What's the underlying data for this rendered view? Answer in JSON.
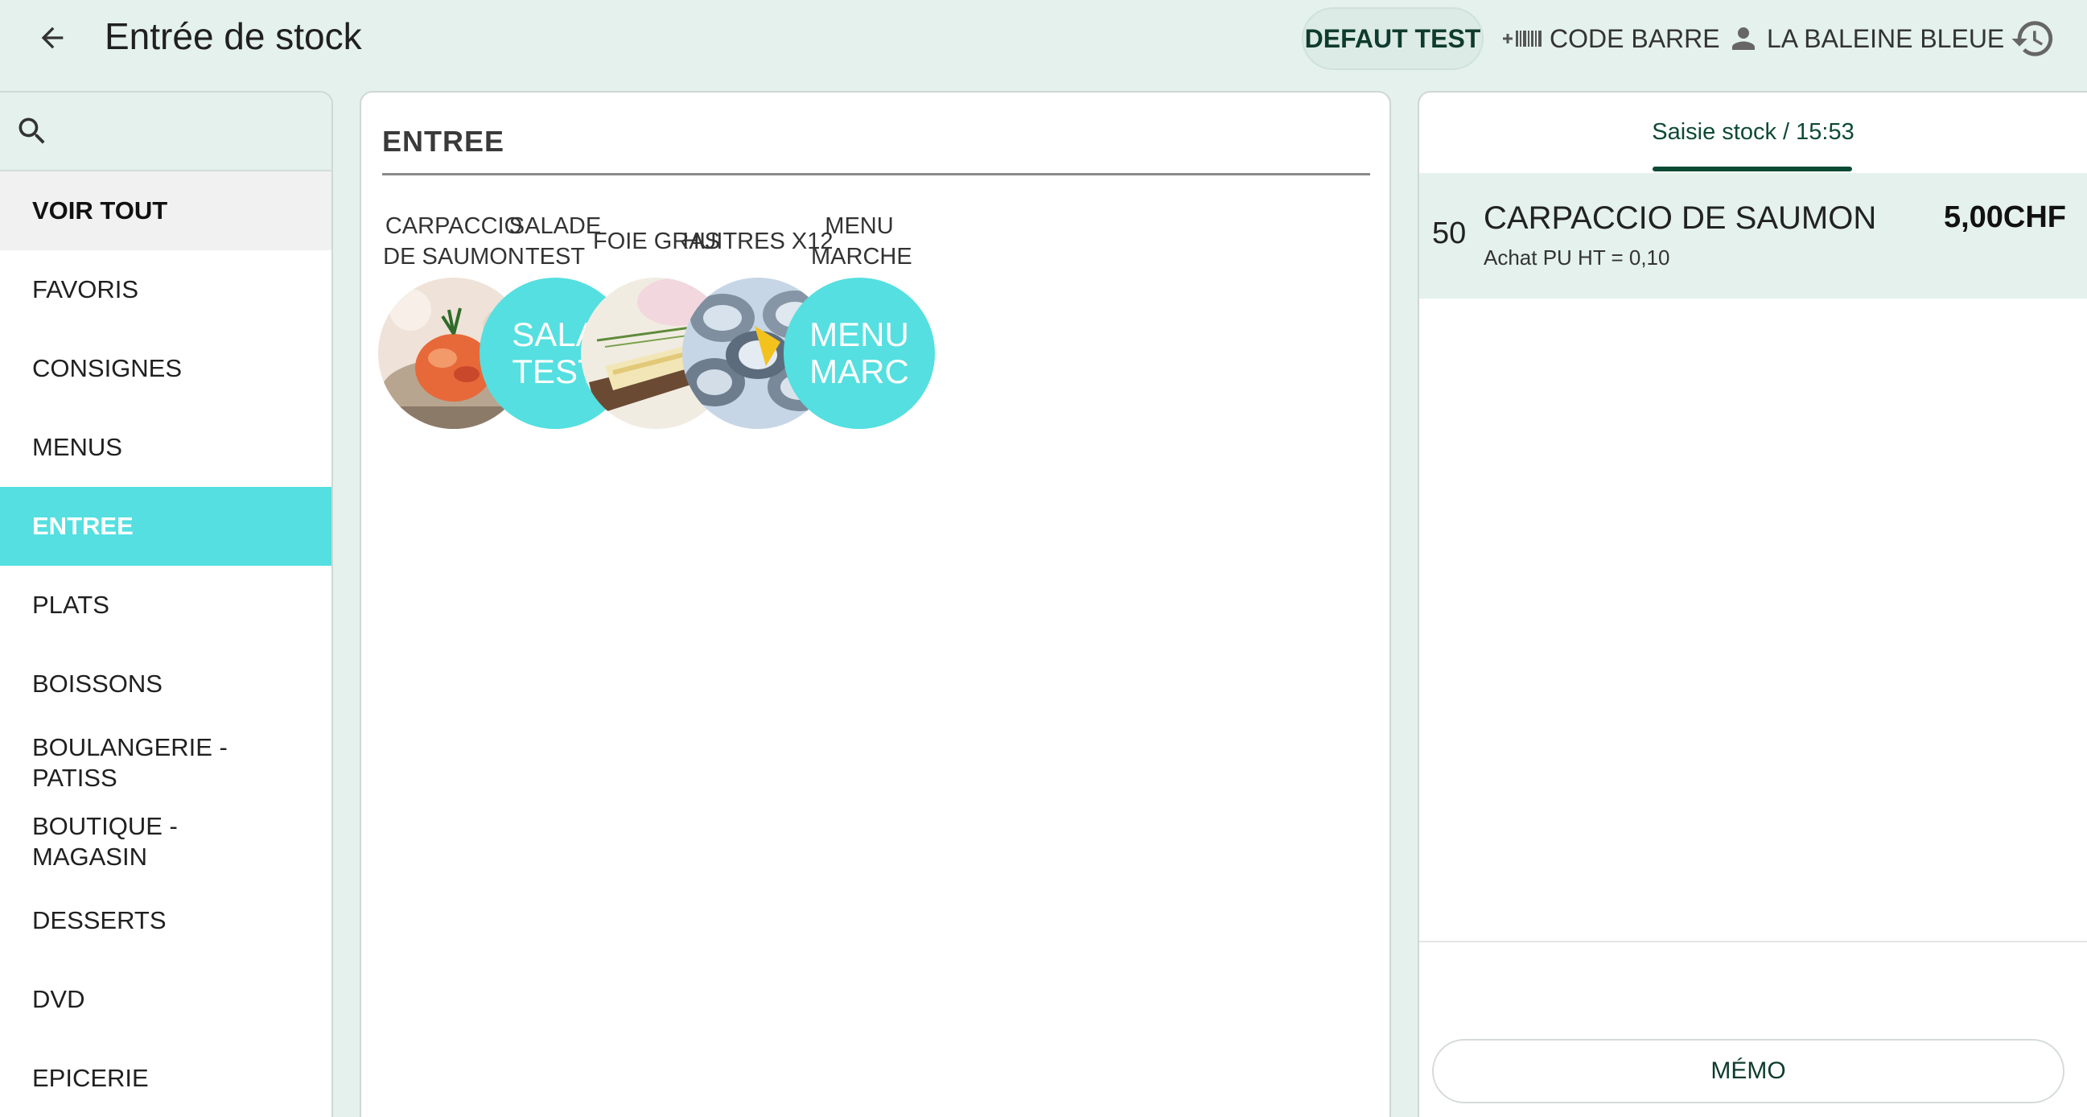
{
  "header": {
    "title": "Entrée de stock",
    "back_icon": "arrow-left-icon",
    "profile_pill": "DEFAUT TEST",
    "barcode_label": "CODE BARRE",
    "store_label": "LA BALEINE BLEUE",
    "history_icon": "history-icon"
  },
  "sidebar": {
    "search_placeholder": "",
    "items": [
      {
        "label": "VOIR TOUT"
      },
      {
        "label": "FAVORIS"
      },
      {
        "label": "CONSIGNES"
      },
      {
        "label": "MENUS"
      },
      {
        "label": "ENTREE"
      },
      {
        "label": "PLATS"
      },
      {
        "label": "BOISSONS"
      },
      {
        "label": "BOULANGERIE - PATISS"
      },
      {
        "label": "BOUTIQUE - MAGASIN"
      },
      {
        "label": "DESSERTS"
      },
      {
        "label": "DVD"
      },
      {
        "label": "EPICERIE"
      }
    ],
    "selected": "ENTREE"
  },
  "products_panel": {
    "category_title": "ENTREE",
    "products": [
      {
        "name": "CARPACCIO DE SAUMON",
        "image": "salmon-carpaccio-photo"
      },
      {
        "name": "SALADE TEST",
        "image_text": "SALA TEST"
      },
      {
        "name": "FOIE GRAS",
        "image": "foie-gras-photo"
      },
      {
        "name": "HUITRES X12",
        "image": "oysters-photo"
      },
      {
        "name": "MENU MARCHE",
        "image_text": "MENU MARC"
      }
    ],
    "accent_color": "#55dfe0"
  },
  "ticket": {
    "tab_label": "Saisie stock / 15:53",
    "lines": [
      {
        "qty": "50",
        "name": "CARPACCIO DE SAUMON",
        "price": "5,00CHF",
        "sub": "Achat PU HT = 0,10"
      }
    ],
    "memo_label": "MÉMO"
  }
}
